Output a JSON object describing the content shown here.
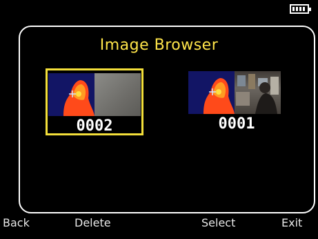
{
  "header": {
    "battery_icon": "battery-full-icon"
  },
  "browser": {
    "title": "Image Browser",
    "images": [
      {
        "label": "0002",
        "selected": true
      },
      {
        "label": "0001",
        "selected": false
      }
    ]
  },
  "softkeys": {
    "back": "Back",
    "delete": "Delete",
    "select": "Select",
    "exit": "Exit"
  },
  "colors": {
    "title": "#ffe54a",
    "selection_border": "#f3df3a",
    "background": "#000000"
  }
}
